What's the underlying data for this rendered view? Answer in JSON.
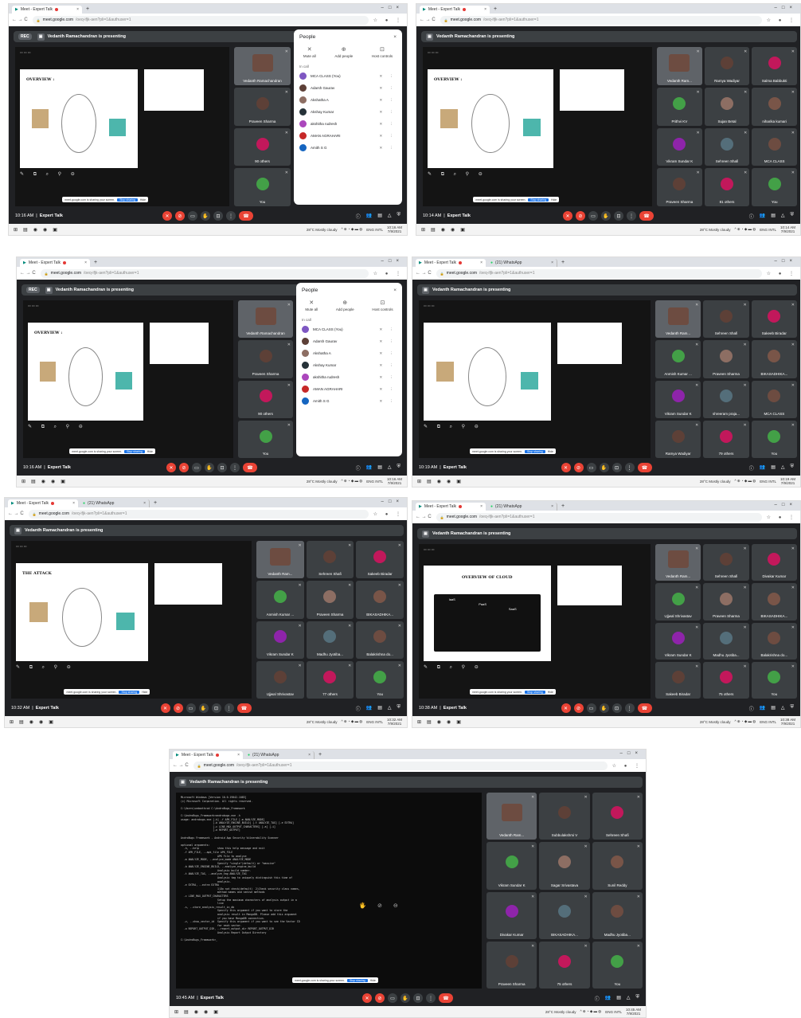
{
  "browser": {
    "tab_meet": "Meet - Expert Talk",
    "tab_whatsapp": "(21) WhatsApp",
    "url_host": "meet.google.com",
    "url_path": "/oeq-ifjk-aen?pli=1&authuser=1"
  },
  "meet": {
    "presenter_banner": "Vedanth Ramachandran is presenting",
    "meeting_name": "Expert Talk",
    "rec_label": "REC",
    "sharing_text": "meet.google.com is sharing your screen.",
    "stop_sharing": "Stop sharing",
    "hide": "Hide"
  },
  "people_panel": {
    "title": "People",
    "actions": [
      "Mute all",
      "Add people",
      "Host controls"
    ],
    "in_call": "In call",
    "participants": [
      "MCA CLASS (You)",
      "Adarsh Gaurav",
      "Akshatha A",
      "Akshay Kumar",
      "akshitha rudresh",
      "AMAN AGRAHARI",
      "Amith S G"
    ]
  },
  "taskbar": {
    "weather": "28°C  Mostly cloudy",
    "lang": "ENG INTL"
  },
  "shots": [
    {
      "time": "10:16 AM",
      "date": "7/9/2021",
      "slide_title": "OVERVIEW :",
      "tiles": [
        "Vedanth Ramachandran",
        "Praveen Sharma",
        "90 others",
        "You"
      ]
    },
    {
      "time": "10:14 AM",
      "date": "7/9/2021",
      "slide_title": "OVERVIEW :",
      "tiles": [
        "Vedanth Ram...",
        "Ramya Wadiyar",
        "Salma Babbukti",
        "Prithvi KV",
        "Sujan Betal",
        "niharika kumari",
        "Vikram Sundar K",
        "Sehreen Shafi",
        "MCA CLASS",
        "Praveen Sharma",
        "81 others",
        "You"
      ]
    },
    {
      "time": "10:16 AM",
      "date": "7/9/2021",
      "slide_title": "OVERVIEW :",
      "tiles": [
        "Vedanth Ramachandran",
        "Praveen Sharma",
        "90 others",
        "You"
      ]
    },
    {
      "time": "10:19 AM",
      "date": "7/9/2021",
      "slide_title": "",
      "tiles": [
        "Vedanth Ram...",
        "Sehreen Shafi",
        "Sakeeb Biradar",
        "Anmish Kumar ...",
        "Praveen Sharma",
        "BIKASADHIKA...",
        "Vikram Sundar K",
        "shreeram praja...",
        "MCA CLASS",
        "Ramya Wadiyar",
        "79 others",
        "You"
      ]
    },
    {
      "time": "10:32 AM",
      "date": "7/9/2021",
      "slide_title": "THE ATTACK",
      "tiles": [
        "Vedanth Ram...",
        "Sehreen Shafi",
        "Sakeeb Biradar",
        "Anmish Kumar ...",
        "Praveen Sharma",
        "BIKASADHIKA...",
        "Vikram Sundar K",
        "Madhu Jyotiba...",
        "Balakrishna do...",
        "Ujjwal Shrivastav",
        "77 others",
        "You"
      ]
    },
    {
      "time": "10:38 AM",
      "date": "7/9/2021",
      "slide_title": "OVERVIEW OF CLOUD",
      "tiles": [
        "Vedanth Ram...",
        "Sehreen Shafi",
        "Divakar Kumar",
        "Ujjwal Shrivastav",
        "Praveen Sharma",
        "BIKASADHIKA...",
        "Vikram Sundar K",
        "Madhu Jyotiba...",
        "Balakrishna do...",
        "Sakeeb Biradar",
        "75 others",
        "You"
      ]
    },
    {
      "time": "10:45 AM",
      "date": "7/9/2021",
      "slide_title": "",
      "tiles": [
        "Vedanth Ram...",
        "Subbulakshmi V",
        "Sehreen Shafi",
        "Vikram Sundar K",
        "Sagar Srivastava",
        "Sunil Reddy",
        "Divakar Kumar",
        "BIKASADHIKA...",
        "Madhu Jyotiba...",
        "Praveen Sharma",
        "75 others",
        "You"
      ]
    }
  ],
  "cloud_layers": [
    "IaaS",
    "PaaS",
    "SaaS"
  ],
  "cmd_text": "Microsoft Windows [Version 10.0.19042.1083]\n(c) Microsoft Corporation. All rights reserved.\n\nC:\\Users\\vedanth>cd C:\\AndroBugs_Framework\n\nC:\\AndroBugs_Framework>androbugs.exe -h\nusage: androbugs.exe [-h] -f APK_FILE [-m ANALYZE_MODE]\n                     [-b ANALYZE_ENGINE_BUILD] [-t ANALYZE_TAG] [-e EXTRA]\n                     [-c LINE_MAX_OUTPUT_CHARACTERS] [-a] [-i]\n                     [-o REPORT_OUTPUT]\n\nAndroBugs Framework - Android App Security Vulnerability Scanner\n\noptional arguments:\n  -h, --help            show this help message and exit\n  -f APK_FILE, --apk_file APK_FILE\n                        APK File to analyze\n  -m ANALYZE_MODE, --analyze_mode ANALYZE_MODE\n                        Specify \"single\"(default) or \"massive\"\n  -b ANALYZE_ENGINE_BUILD, --analyze_engine_build\n                        Analysis build number.\n  -t ANALYZE_TAG, --analyze_tag ANALYZE_TAG\n                        Analysis tag to uniquely distinguish this time of\n                        analysis.\n  -e EXTRA, --extra EXTRA\n                        1)Do not check(default)  2)Check security class names,\n                        method names and native methods\n  -c LINE_MAX_OUTPUT_CHARACTERS\n                        Setup the maximum characters of analysis output in a\n                        line\n  -s, --store_analysis_result_in_db\n                        Specify this argument if you want to store the\n                        analysis result in MongoDB. Please add this argument\n                        if you have MongoDB connection.\n  -v, --show_vector_id  Specify this argument if you want to see the Vector ID\n                        for each vector.\n  -o REPORT_OUTPUT_DIR, --report_output_dir REPORT_OUTPUT_DIR\n                        Analysis Report Output Directory\n\nC:\\AndroBugs_Framework>_"
}
